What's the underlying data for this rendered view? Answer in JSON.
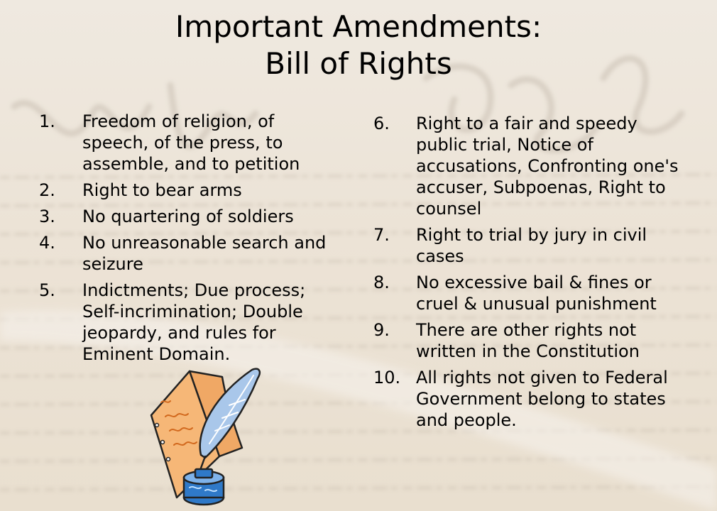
{
  "slide": {
    "title_line1": "Important Amendments:",
    "title_line2": "Bill of Rights"
  },
  "left_list": [
    {
      "number": "1.",
      "text": "Freedom of religion, of speech, of the press, to assemble, and to petition"
    },
    {
      "number": "2.",
      "text": "Right to bear arms"
    },
    {
      "number": "3.",
      "text": "No quartering of soldiers"
    },
    {
      "number": "4.",
      "text": "No unreasonable search and seizure"
    },
    {
      "number": "5.",
      "text": "Indictments; Due process; Self-incrimination; Double jeopardy, and rules for Eminent Domain."
    }
  ],
  "right_list": [
    {
      "number": "6.",
      "text": "Right to a fair and speedy public trial, Notice of accusations, Confronting one's accuser, Subpoenas, Right to counsel"
    },
    {
      "number": "7.",
      "text": "Right to trial by jury in civil cases"
    },
    {
      "number": "8.",
      "text": "No excessive bail & fines or cruel & unusual punishment"
    },
    {
      "number": "9.",
      "text": "There are other rights not written in the Constitution"
    },
    {
      "number": "10.",
      "text": "All rights not given to Federal Government belong to states and people."
    }
  ],
  "background": {
    "icon": "constitution-parchment-background",
    "base_color": "#ece3d6",
    "ink_color": "#8a8178"
  },
  "clipart": {
    "icon": "quill-paper-inkwell-icon",
    "paper_color": "#f6b777",
    "quill_color": "#a9c7ea",
    "ink_color": "#2f79c8"
  }
}
